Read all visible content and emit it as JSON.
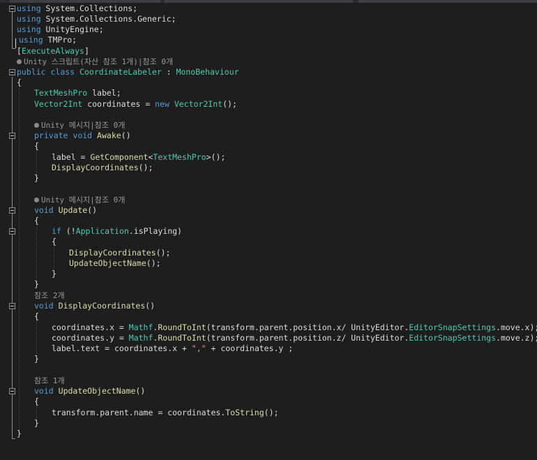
{
  "lines": {
    "l1": [
      "using",
      " System.Collections;"
    ],
    "l2": [
      "using",
      " System.Collections.Generic;"
    ],
    "l3": [
      "using",
      " UnityEngine;"
    ],
    "l4": [
      "using",
      " TMPro;"
    ],
    "l5": [
      "[",
      "ExecuteAlways",
      "]"
    ],
    "l6": "Unity 스크립트(자산 참조 1개)|참조 0개",
    "l7": [
      "public",
      " ",
      "class",
      " ",
      "CoordinateLabeler",
      " : ",
      "MonoBehaviour"
    ],
    "l8": "{",
    "l9": [
      "TextMeshPro",
      " label;"
    ],
    "l10": [
      "Vector2Int",
      " coordinates = ",
      "new",
      " ",
      "Vector2Int",
      "();"
    ],
    "l11": "Unity 메시지|참조 0개",
    "l12": [
      "private",
      " ",
      "void",
      " ",
      "Awake",
      "()"
    ],
    "l13": "{",
    "l14": [
      "label = ",
      "GetComponent",
      "<",
      "TextMeshPro",
      ">();"
    ],
    "l15": [
      "DisplayCoordinates",
      "();"
    ],
    "l16": "}",
    "l17": "Unity 메시지|참조 0개",
    "l18": [
      "void",
      " ",
      "Update",
      "()"
    ],
    "l19": "{",
    "l20": [
      "if",
      " (!",
      "Application",
      ".isPlaying)"
    ],
    "l21": "{",
    "l22": [
      "DisplayCoordinates",
      "();"
    ],
    "l23": [
      "UpdateObjectName",
      "();"
    ],
    "l24": "}",
    "l25": "}",
    "l26": "참조 2개",
    "l27": [
      "void",
      " ",
      "DisplayCoordinates",
      "()"
    ],
    "l28": "{",
    "l29": [
      "coordinates.x = ",
      "Mathf",
      ".",
      "RoundToInt",
      "(transform.parent.position.x/ UnityEditor.",
      "EditorSnapSettings",
      ".move.x);"
    ],
    "l30": [
      "coordinates.y = ",
      "Mathf",
      ".",
      "RoundToInt",
      "(transform.parent.position.z/ UnityEditor.",
      "EditorSnapSettings",
      ".move.z);"
    ],
    "l31": [
      "label.text = coordinates.x + ",
      "\",\"",
      " + coordinates.y ;"
    ],
    "l32": "}",
    "l33": "참조 1개",
    "l34": [
      "void",
      " ",
      "UpdateObjectName",
      "()"
    ],
    "l35": "{",
    "l36": [
      "transform.parent.name = coordinates.",
      "ToString",
      "();"
    ],
    "l37": "}",
    "l38": "}"
  },
  "colors": {
    "background": "#1e1e1e",
    "keyword": "#569cd6",
    "type": "#4ec9b0",
    "method": "#dcdcaa",
    "text": "#dcdcdc",
    "string": "#d69d85",
    "codelens": "#999999"
  }
}
